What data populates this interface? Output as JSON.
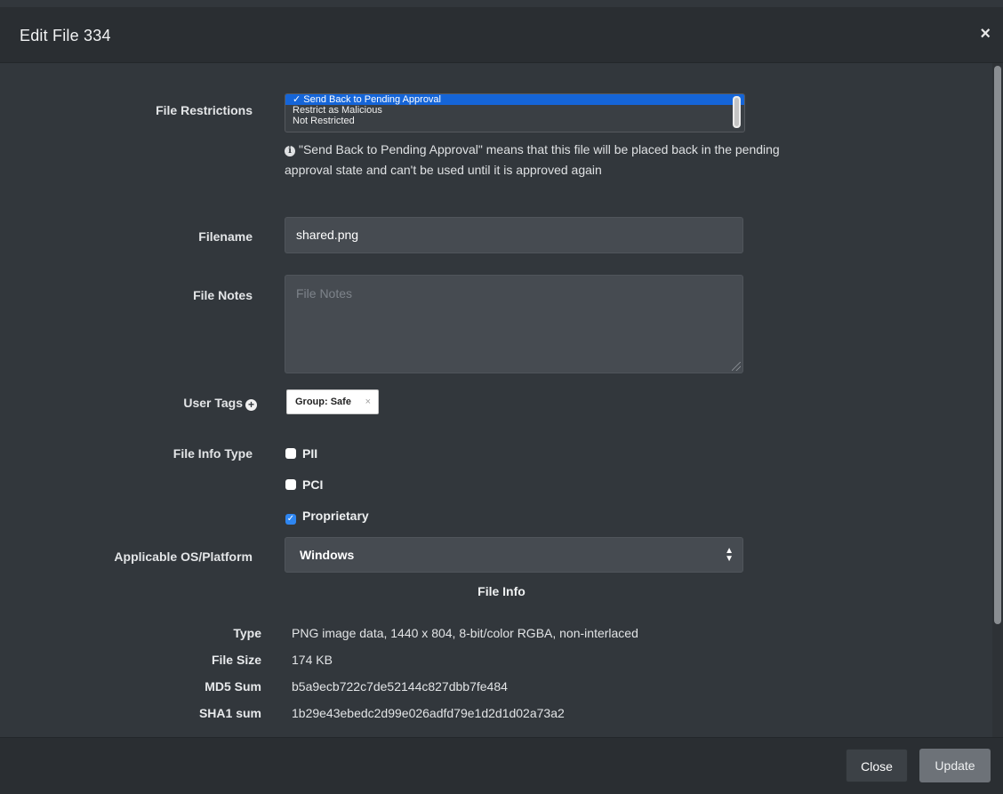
{
  "modal": {
    "title": "Edit File 334",
    "close_glyph": "×"
  },
  "restrictions": {
    "label": "File Restrictions",
    "options": [
      {
        "label": "✓ Send Back to Pending Approval"
      },
      {
        "label": "Restrict as Malicious"
      },
      {
        "label": "Not Restricted"
      }
    ],
    "selected_index": 0,
    "help_text": "\"Send Back to Pending Approval\" means that this file will be placed back in the pending approval state and can't be used until it is approved again"
  },
  "filename": {
    "label": "Filename",
    "value": "shared.png"
  },
  "notes": {
    "label": "File Notes",
    "placeholder": "File Notes"
  },
  "user_tags": {
    "label": "User Tags",
    "tags": [
      {
        "label": "Group: Safe",
        "remove": "×"
      }
    ]
  },
  "file_info_type": {
    "label": "File Info Type",
    "options": [
      {
        "label": "PII",
        "checked": false
      },
      {
        "label": "PCI",
        "checked": false
      },
      {
        "label": "Proprietary",
        "checked": true
      }
    ]
  },
  "platform": {
    "label": "Applicable OS/Platform",
    "value": "Windows"
  },
  "file_info": {
    "title": "File Info",
    "rows": [
      {
        "label": "Type",
        "value": "PNG image data, 1440 x 804, 8-bit/color RGBA, non-interlaced"
      },
      {
        "label": "File Size",
        "value": "174 KB"
      },
      {
        "label": "MD5 Sum",
        "value": "b5a9ecb722c7de52144c827dbb7fe484"
      },
      {
        "label": "SHA1 sum",
        "value": "1b29e43ebedc2d99e026adfd79e1d2d1d02a73a2"
      }
    ]
  },
  "footer": {
    "close_label": "Close",
    "update_label": "Update"
  },
  "colors": {
    "modal_bg": "#32373c",
    "header_bg": "#2a2e32",
    "selected_option": "#1565d8",
    "checkbox_checked": "#2e86f1"
  }
}
